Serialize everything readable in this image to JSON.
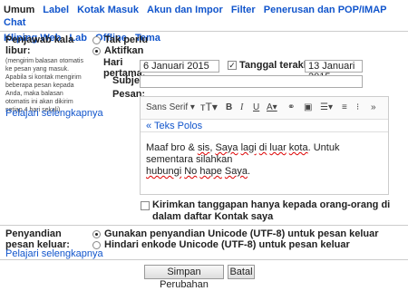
{
  "tabs": {
    "row1": [
      "Umum",
      "Label",
      "Kotak Masuk",
      "Akun dan Impor",
      "Filter",
      "Penerusan dan POP/IMAP",
      "Chat"
    ],
    "row2": [
      "Kliping Web",
      "Lab",
      "Offline",
      "Tema"
    ],
    "active": "Umum"
  },
  "vacation": {
    "title": "Penjawab kala libur:",
    "description": "(mengirim balasan otomatis ke pesan yang masuk. Apabila si kontak mengirim beberapa pesan kepada Anda, maka balasan otomatis ini akan dikirim setiap 4 hari sekali)",
    "learn_more": "Pelajari selengkapnya",
    "option_off": "Tak perlu",
    "option_on": "Aktifkan",
    "first_day_label": "Hari pertama:",
    "first_day_value": "6 Januari 2015",
    "last_day_label": "Tanggal terakhir:",
    "last_day_value": "13 Januari 2015",
    "subject_label": "Subjek:",
    "subject_value": "",
    "message_label": "Pesan:",
    "font_name": "Sans Serif",
    "plain_text_link": "« Teks Polos",
    "message_line1_a": "Maaf bro & ",
    "message_line1_b": "sis",
    "message_line1_c": ", ",
    "message_line1_d": "Saya",
    "message_line1_e": " ",
    "message_line1_f": "lagi",
    "message_line1_g": " ",
    "message_line1_h": "di",
    "message_line1_i": " ",
    "message_line1_j": "luar",
    "message_line1_k": " ",
    "message_line1_l": "kota",
    "message_line1_m": ". Untuk sementara silahkan",
    "message_line2_a": "hubungi",
    "message_line2_b": " ",
    "message_line2_c": "No",
    "message_line2_d": " ",
    "message_line2_e": "hape",
    "message_line2_f": " ",
    "message_line2_g": "Saya",
    "message_line2_h": ".",
    "contacts_only": "Kirimkan tanggapan hanya kepada orang-orang di dalam daftar Kontak saya"
  },
  "encoding": {
    "title": "Penyandian pesan keluar:",
    "learn_more": "Pelajari selengkapnya",
    "option_utf8": "Gunakan penyandian Unicode (UTF-8) untuk pesan keluar",
    "option_avoid": "Hindari enkode Unicode (UTF-8) untuk pesan keluar"
  },
  "footer": {
    "save_label": "Simpan Perubahan",
    "cancel_label": "Batal"
  }
}
